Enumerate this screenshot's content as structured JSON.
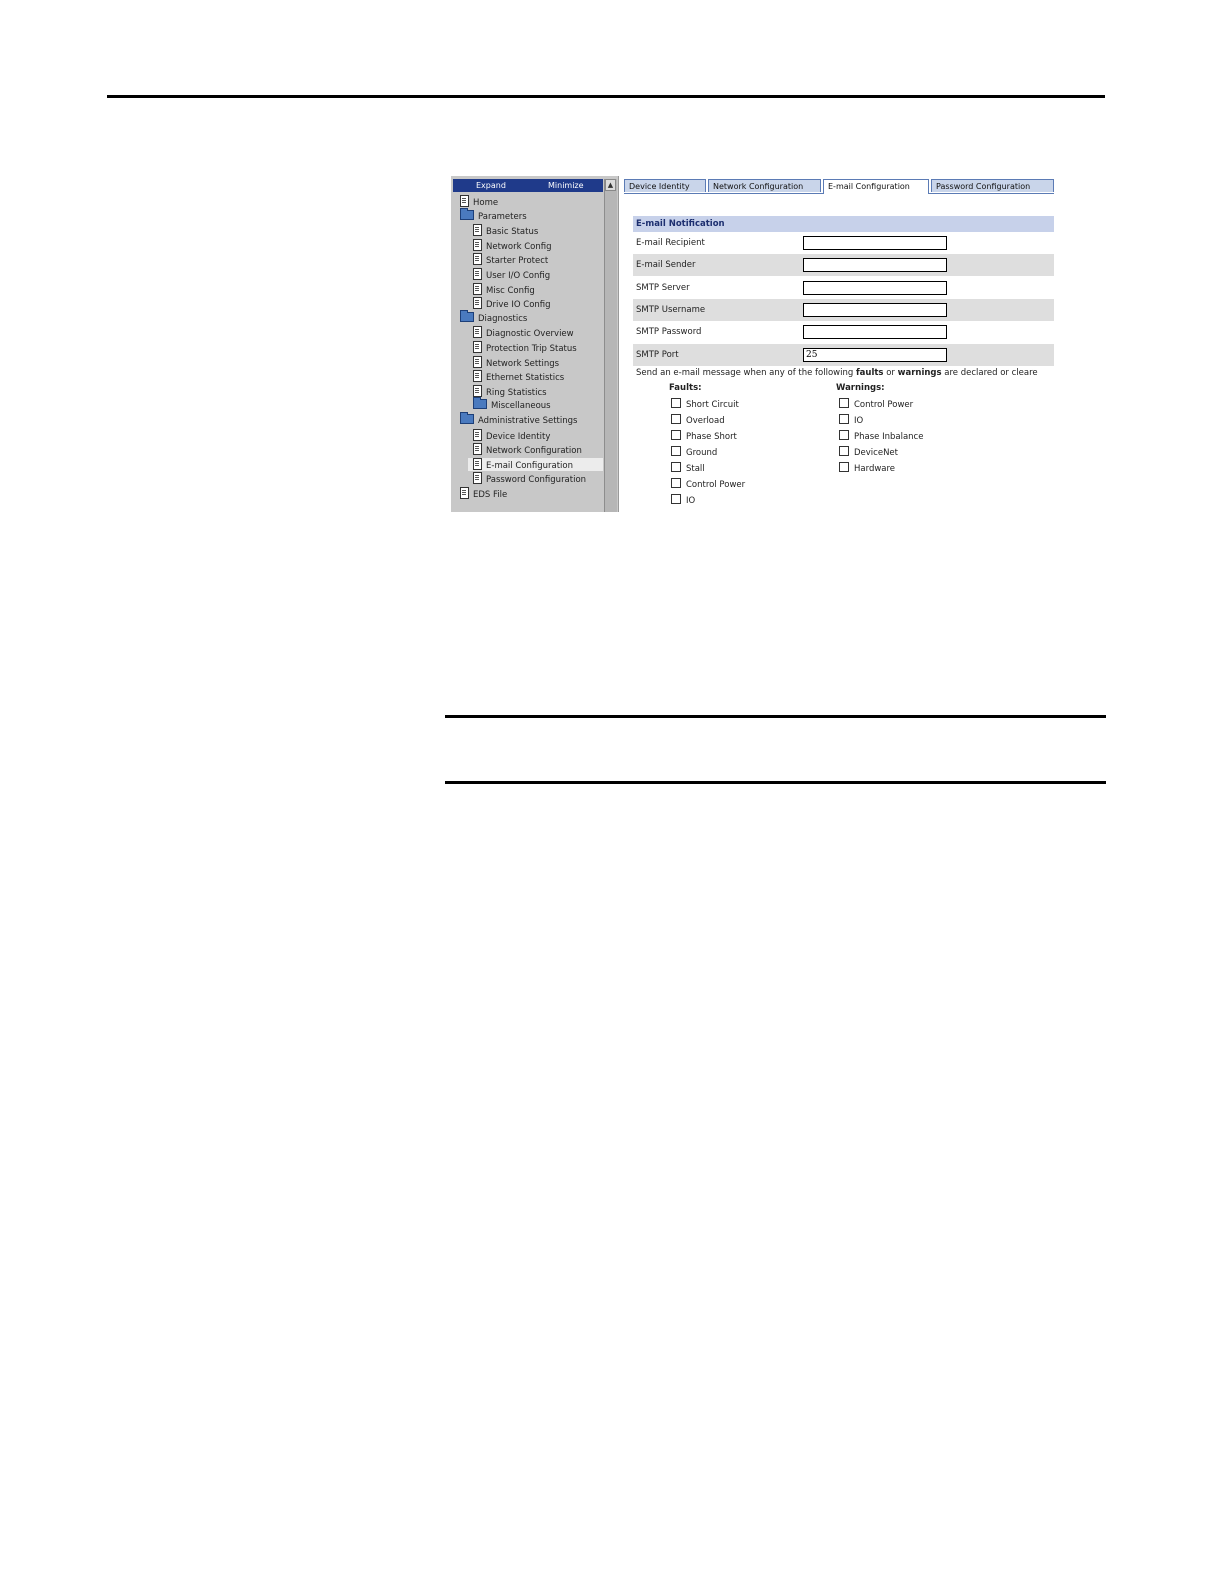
{
  "nav": {
    "expand_label": "Expand",
    "minimize_label": "Minimize",
    "items": [
      {
        "label": "Home",
        "icon": "document-icon",
        "level": 0
      },
      {
        "label": "Parameters",
        "icon": "folder-icon",
        "level": 0
      },
      {
        "label": "Basic Status",
        "icon": "document-icon",
        "level": 1
      },
      {
        "label": "Network Config",
        "icon": "document-icon",
        "level": 1
      },
      {
        "label": "Starter Protect",
        "icon": "document-icon",
        "level": 1
      },
      {
        "label": "User I/O Config",
        "icon": "document-icon",
        "level": 1
      },
      {
        "label": "Misc Config",
        "icon": "document-icon",
        "level": 1
      },
      {
        "label": "Drive IO Config",
        "icon": "document-icon",
        "level": 1
      },
      {
        "label": "Diagnostics",
        "icon": "folder-icon",
        "level": 0
      },
      {
        "label": "Diagnostic Overview",
        "icon": "document-icon",
        "level": 1
      },
      {
        "label": "Protection Trip Status",
        "icon": "document-icon",
        "level": 1
      },
      {
        "label": "Network Settings",
        "icon": "document-icon",
        "level": 1
      },
      {
        "label": "Ethernet Statistics",
        "icon": "document-icon",
        "level": 1
      },
      {
        "label": "Ring Statistics",
        "icon": "document-icon",
        "level": 1
      },
      {
        "label": "Miscellaneous",
        "icon": "folder-icon",
        "level": 1
      },
      {
        "label": "Administrative Settings",
        "icon": "folder-icon",
        "level": 0
      },
      {
        "label": "Device Identity",
        "icon": "document-icon",
        "level": 1
      },
      {
        "label": "Network Configuration",
        "icon": "document-icon",
        "level": 1
      },
      {
        "label": "E-mail Configuration",
        "icon": "document-icon",
        "level": 1,
        "selected": true
      },
      {
        "label": "Password Configuration",
        "icon": "document-icon",
        "level": 1
      },
      {
        "label": "EDS File",
        "icon": "document-icon",
        "level": 0
      }
    ]
  },
  "tabs": [
    {
      "label": "Device Identity"
    },
    {
      "label": "Network Configuration"
    },
    {
      "label": "E-mail Configuration",
      "active": true
    },
    {
      "label": "Password Configuration"
    }
  ],
  "form": {
    "section_title": "E-mail Notification",
    "fields": [
      {
        "label": "E-mail Recipient",
        "value": ""
      },
      {
        "label": "E-mail Sender",
        "value": ""
      },
      {
        "label": "SMTP Server",
        "value": ""
      },
      {
        "label": "SMTP Username",
        "value": ""
      },
      {
        "label": "SMTP Password",
        "value": ""
      },
      {
        "label": "SMTP Port",
        "value": "25"
      }
    ],
    "send_text_before": "Send an e-mail message when any of the following ",
    "send_text_faults": "faults",
    "send_text_or": " or ",
    "send_text_warnings": "warnings",
    "send_text_after": " are declared or cleare",
    "faults_heading": "Faults:",
    "warnings_heading": "Warnings:",
    "faults": [
      "Short Circuit",
      "Overload",
      "Phase Short",
      "Ground",
      "Stall",
      "Control Power",
      "IO"
    ],
    "warnings": [
      "Control Power",
      "IO",
      "Phase Inbalance",
      "DeviceNet",
      "Hardware"
    ]
  },
  "colors": {
    "nav_header": "#1f3a8a",
    "section_header": "#c7d1ea",
    "tab_inactive": "#c9d5ea"
  }
}
